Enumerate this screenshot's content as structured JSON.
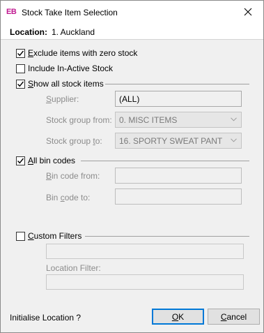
{
  "window": {
    "app_icon": "EB",
    "title": "Stock Take Item Selection",
    "close_icon": "close-icon"
  },
  "location": {
    "label": "Location:",
    "value": "1. Auckland"
  },
  "options": {
    "exclude_zero": {
      "pre": "",
      "key": "E",
      "post": "xclude items with zero stock",
      "checked": true
    },
    "include_inactive": {
      "label": "Include In-Active Stock",
      "checked": false
    },
    "show_all_stock": {
      "pre": "",
      "key": "S",
      "post": "how all stock items",
      "checked": true
    }
  },
  "stock_filters": {
    "supplier_label_key": "S",
    "supplier_label_post": "upplier:",
    "supplier_value": "(ALL)",
    "group_from_label_pre": "Stock ",
    "group_from_label_key": "g",
    "group_from_label_post": "roup from:",
    "group_from_value": "0. MISC ITEMS",
    "group_to_label_pre": "Stock group ",
    "group_to_label_key": "t",
    "group_to_label_post": "o:",
    "group_to_value": "16. SPORTY SWEAT PANT"
  },
  "bin": {
    "all_bin_pre": "",
    "all_bin_key": "A",
    "all_bin_post": "ll bin codes",
    "checked": true,
    "from_label_key": "B",
    "from_label_post": "in code from:",
    "to_label_pre": "Bin ",
    "to_label_key": "c",
    "to_label_post": "ode to:",
    "from_value": "",
    "to_value": ""
  },
  "custom": {
    "label_pre": "",
    "label_key": "C",
    "label_post": "ustom Filters",
    "checked": false,
    "filter_value": "",
    "location_filter_label": "Location Filter:",
    "location_filter_value": ""
  },
  "footer": {
    "initialise_label": "Initialise Location ?",
    "ok_key": "O",
    "ok_post": "K",
    "cancel_key": "C",
    "cancel_post": "ancel"
  }
}
